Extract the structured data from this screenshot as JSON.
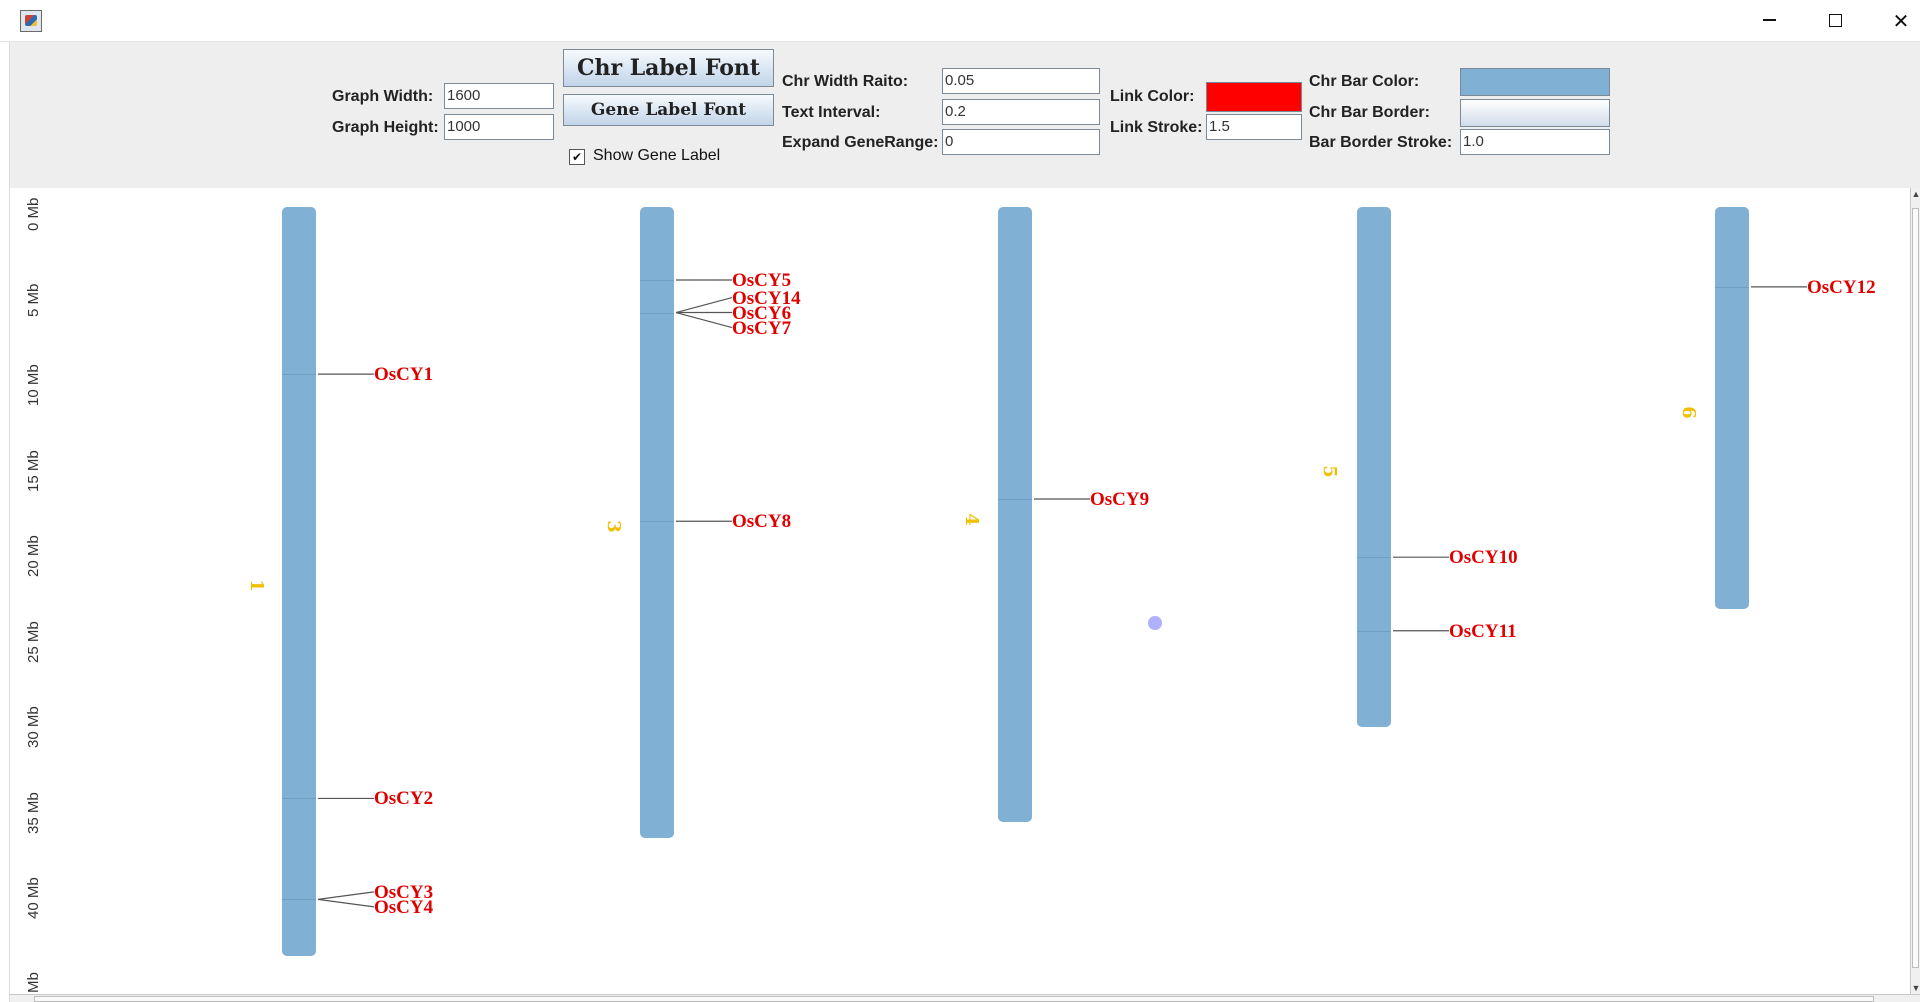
{
  "window": {
    "icon": "java-app-icon",
    "minimize_icon": "minimize-icon",
    "maximize_icon": "maximize-icon",
    "close_icon": "close-icon",
    "close_glyph": "✕"
  },
  "toolbar": {
    "graph_width_label": "Graph Width:",
    "graph_width_value": "1600",
    "graph_height_label": "Graph Height:",
    "graph_height_value": "1000",
    "chr_label_font_button": "Chr Label Font",
    "gene_label_font_button": "Gene Label Font",
    "show_gene_label": "Show Gene Label",
    "show_gene_label_checked": true,
    "check_glyph": "✔",
    "chr_width_ratio_label": "Chr Width Raito:",
    "chr_width_ratio_value": "0.05",
    "text_interval_label": "Text Interval:",
    "text_interval_value": "0.2",
    "expand_gene_range_label": "Expand GeneRange:",
    "expand_gene_range_value": "0",
    "link_color_label": "Link Color:",
    "link_color": "#ff0000",
    "link_stroke_label": "Link Stroke:",
    "link_stroke_value": "1.5",
    "chr_bar_color_label": "Chr Bar Color:",
    "chr_bar_color": "#80b0d4",
    "chr_bar_border_label": "Chr Bar Border:",
    "bar_border_stroke_label": "Bar Border Stroke:",
    "bar_border_stroke_value": "1.0"
  },
  "graph": {
    "ruler_labels": [
      "0 Mb",
      "5 Mb",
      "10 Mb",
      "15 Mb",
      "20 Mb",
      "25 Mb",
      "30 Mb",
      "35 Mb",
      "40 Mb",
      "Mb"
    ],
    "label_color": "#e00000",
    "chr_number_color": "#f0c000",
    "link_line_color": "#555555",
    "chromosomes": [
      {
        "id": "1",
        "length_mb": 43.3,
        "genes": [
          {
            "name": "OsCY1",
            "pos_mb": 9.3
          },
          {
            "name": "OsCY2",
            "pos_mb": 34.1
          },
          {
            "name": "OsCY3",
            "pos_mb": 40.0
          },
          {
            "name": "OsCY4",
            "pos_mb": 40.0
          }
        ]
      },
      {
        "id": "3",
        "length_mb": 36.4,
        "genes": [
          {
            "name": "OsCY5",
            "pos_mb": 3.8
          },
          {
            "name": "OsCY14",
            "pos_mb": 5.7
          },
          {
            "name": "OsCY6",
            "pos_mb": 5.7
          },
          {
            "name": "OsCY7",
            "pos_mb": 5.7
          },
          {
            "name": "OsCY8",
            "pos_mb": 17.9
          }
        ]
      },
      {
        "id": "4",
        "length_mb": 35.5,
        "genes": [
          {
            "name": "OsCY9",
            "pos_mb": 16.6
          }
        ]
      },
      {
        "id": "5",
        "length_mb": 29.9,
        "genes": [
          {
            "name": "OsCY10",
            "pos_mb": 20.0
          },
          {
            "name": "OsCY11",
            "pos_mb": 24.3
          }
        ]
      },
      {
        "id": "6",
        "length_mb": 23.0,
        "genes": [
          {
            "name": "OsCY12",
            "pos_mb": 4.2
          }
        ]
      }
    ]
  }
}
